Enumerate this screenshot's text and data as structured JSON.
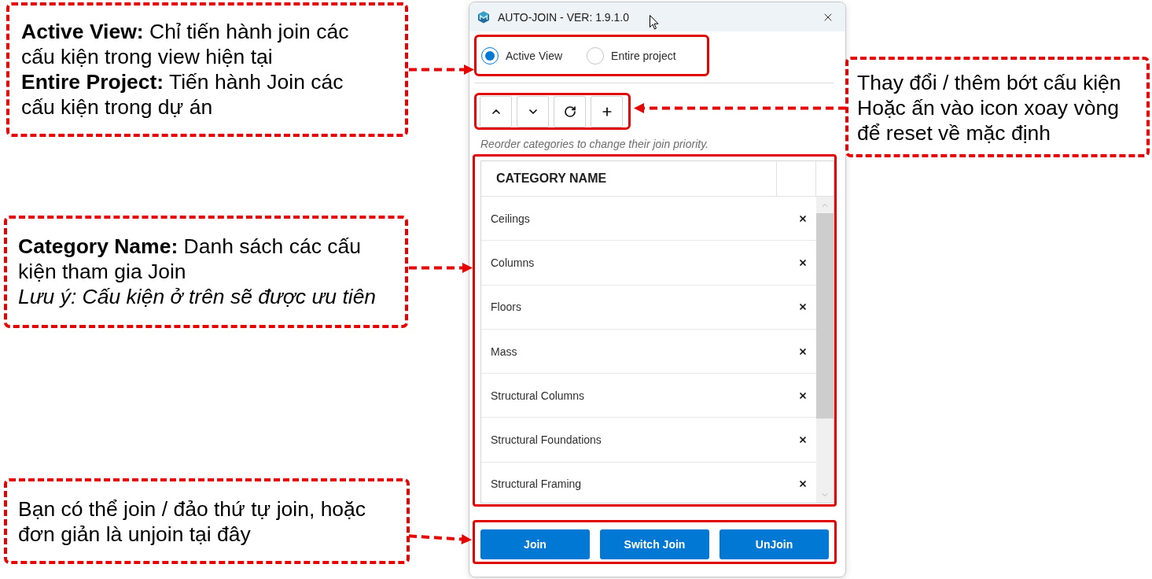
{
  "callouts_left": [
    {
      "paragraphs": [
        {
          "text": "**Active View:** Chỉ tiến hành join các cấu kiện trong view hiện tại",
          "italic": false
        },
        {
          "text": "**Entire Project:** Tiến hành Join các cấu kiện trong dự án",
          "italic": false
        }
      ]
    },
    {
      "paragraphs": [
        {
          "text": "**Category Name:** Danh sách các cấu kiện tham gia Join",
          "italic": false
        },
        {
          "text": "Lưu ý: Cấu kiện ở trên sẽ được ưu tiên",
          "italic": true
        }
      ]
    },
    {
      "paragraphs": [
        {
          "text": "Bạn có thể join / đảo thứ tự join, hoặc đơn giản là unjoin tại đây",
          "italic": false
        }
      ]
    }
  ],
  "window": {
    "title": "AUTO-JOIN - VER: 1.9.1.0",
    "scope_options": [
      {
        "label": "Active View",
        "selected": true
      },
      {
        "label": "Entire project",
        "selected": false
      }
    ],
    "toolbar": [
      {
        "kind": "move_up"
      },
      {
        "kind": "move_down"
      },
      {
        "kind": "reset"
      },
      {
        "kind": "add"
      }
    ],
    "hint": "Reorder categories to change their join priority.",
    "table": {
      "columns": [
        "CATEGORY NAME"
      ],
      "rows": [
        {
          "category_name": "Ceilings"
        },
        {
          "category_name": "Columns"
        },
        {
          "category_name": "Floors"
        },
        {
          "category_name": "Mass"
        },
        {
          "category_name": "Structural Columns"
        },
        {
          "category_name": "Structural Foundations"
        },
        {
          "category_name": "Structural Framing"
        }
      ]
    },
    "buttons": [
      "Join",
      "Switch Join",
      "UnJoin"
    ]
  },
  "callout_right": {
    "paragraphs": [
      {
        "text": "Thay đổi / thêm bớt cấu kiện",
        "italic": false
      },
      {
        "text": "Hoặc ấn vào icon xoay vòng để reset về mặc định",
        "italic": false
      }
    ]
  }
}
